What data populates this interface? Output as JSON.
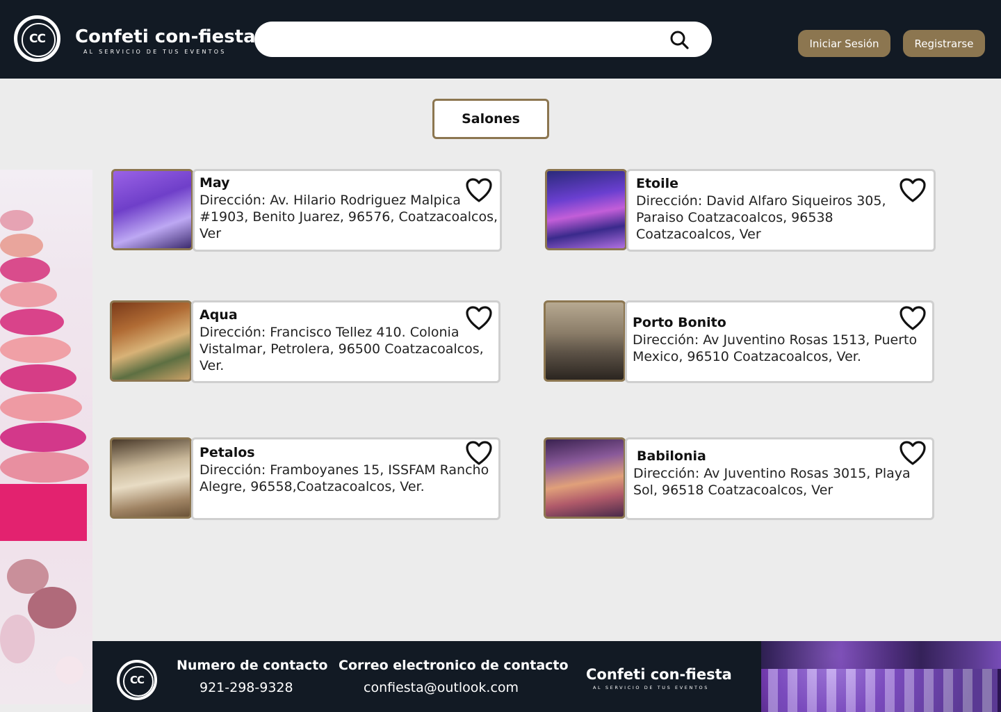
{
  "header": {
    "logo_mark": "CC",
    "brand_name": "Confeti con-fiesta",
    "brand_tagline": "AL SERVICIO DE TUS EVENTOS",
    "search": {
      "value": "",
      "placeholder": ""
    },
    "login_label": "Iniciar Sesión",
    "register_label": "Registrarse"
  },
  "section_button": "Salones",
  "venues": [
    {
      "name": "May",
      "address": "Dirección: Av. Hilario Rodriguez Malpica #1903, Benito Juarez, 96576, Coatzacoalcos, Ver"
    },
    {
      "name": "Etoile",
      "address": "Dirección: David Alfaro Siqueiros 305, Paraiso Coatzacoalcos, 96538 Coatzacoalcos, Ver"
    },
    {
      "name": "Aqua",
      "address": "Dirección: Francisco Tellez 410. Colonia Vistalmar, Petrolera, 96500 Coatzacoalcos, Ver."
    },
    {
      "name": "Porto Bonito",
      "address": "Dirección:  Av Juventino Rosas 1513, Puerto Mexico, 96510 Coatzacoalcos, Ver."
    },
    {
      "name": "Petalos",
      "address": "Dirección: Framboyanes 15, ISSFAM Rancho Alegre, 96558,Coatzacoalcos, Ver."
    },
    {
      "name": "Babilonia",
      "address": "Dirección: Av Juventino Rosas 3015, Playa Sol, 96518 Coatzacoalcos, Ver"
    }
  ],
  "footer": {
    "logo_mark": "CC",
    "phone_heading": "Numero de contacto",
    "phone": "921-298-9328",
    "email_heading": "Correo electronico de contacto",
    "email": "confiesta@outlook.com",
    "brand_name": "Confeti con-fiesta",
    "brand_tagline": "AL SERVICIO DE TUS EVENTOS"
  },
  "icons": {
    "search": "search-icon",
    "favorite": "heart-outline-icon"
  },
  "colors": {
    "header_bg": "#121a24",
    "accent": "#8c7650",
    "page_bg": "#ececec"
  }
}
